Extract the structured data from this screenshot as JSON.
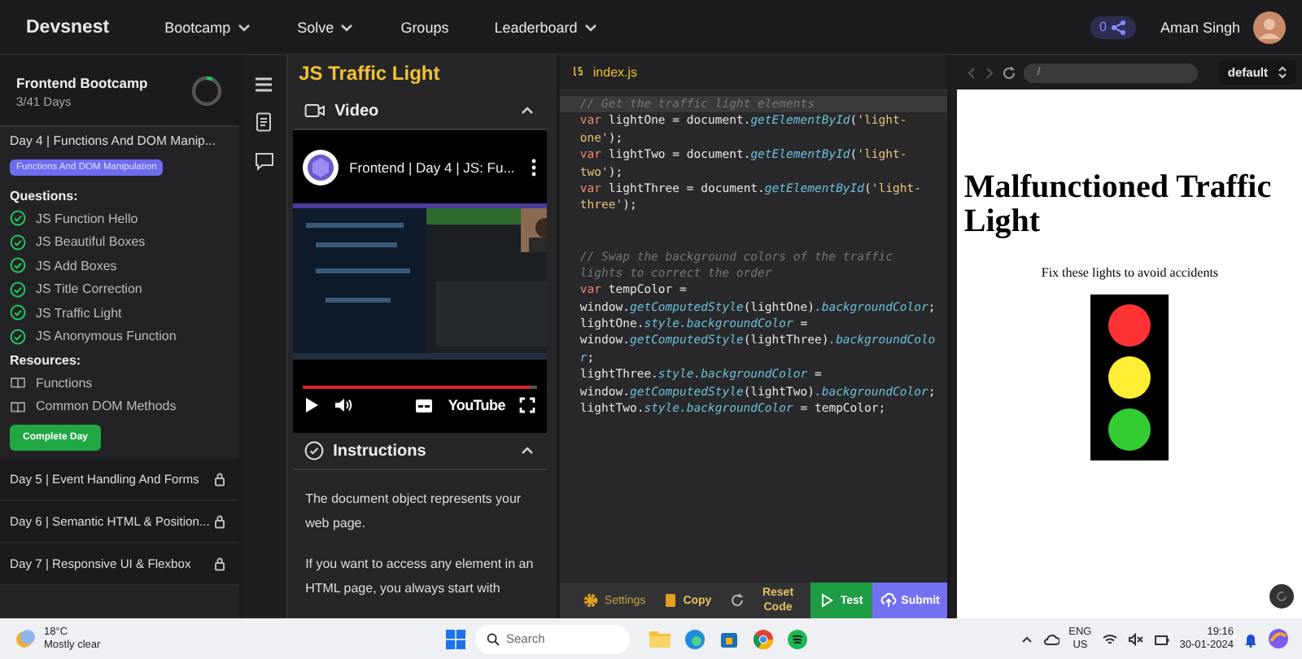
{
  "nav": {
    "brand": "Devsnest",
    "menus": [
      {
        "label": "Bootcamp",
        "dropdown": true
      },
      {
        "label": "Solve",
        "dropdown": true
      },
      {
        "label": "Groups",
        "dropdown": false
      },
      {
        "label": "Leaderboard",
        "dropdown": true
      }
    ],
    "share_count": "0",
    "user": "Aman Singh"
  },
  "sidebar": {
    "course": "Frontend Bootcamp",
    "progress_text": "3/41 Days",
    "progress": {
      "level": 0.07
    },
    "current_day": {
      "title": "Day 4 | Functions And DOM Manip...",
      "tag": "Functions And DOM Manipulation",
      "questions_heading": "Questions:",
      "questions": [
        {
          "label": "JS Function Hello",
          "completed": true
        },
        {
          "label": "JS Beautiful Boxes",
          "completed": true
        },
        {
          "label": "JS Add Boxes",
          "completed": true
        },
        {
          "label": "JS Title Correction",
          "completed": true
        },
        {
          "label": "JS Traffic Light",
          "completed": true
        },
        {
          "label": "JS Anonymous Function",
          "completed": true
        }
      ],
      "resources_heading": "Resources:",
      "resources": [
        "Functions",
        "Common DOM Methods"
      ],
      "complete_button": "Complete Day"
    },
    "days": [
      {
        "label": "Day 5 | Event Handling And Forms",
        "locked": true
      },
      {
        "label": "Day 6 | Semantic HTML & Position...",
        "locked": true
      },
      {
        "label": "Day 7 | Responsive UI & Flexbox",
        "locked": true
      }
    ]
  },
  "lesson": {
    "title": "JS Traffic Light",
    "video_heading": "Video",
    "video": {
      "title": "Frontend | Day 4 | JS: Fu...",
      "progress": {
        "level": 0.97
      },
      "logo": "YouTube"
    },
    "instructions_heading": "Instructions",
    "paragraphs": [
      "The document object represents your web page.",
      "If you want to access any element in an HTML page, you always start with"
    ]
  },
  "editor": {
    "file": "index.js",
    "lines": [
      {
        "highlighted": true,
        "gap_before": false,
        "tokens": [
          {
            "kind": "comment",
            "text": "// Get the traffic light elements"
          }
        ]
      },
      {
        "highlighted": false,
        "gap_before": false,
        "tokens": [
          {
            "kind": "keyword",
            "text": "var"
          },
          {
            "kind": "plain",
            "text": " lightOne = document."
          },
          {
            "kind": "method",
            "text": "getElementById"
          },
          {
            "kind": "plain",
            "text": "("
          },
          {
            "kind": "string",
            "text": "'light-"
          }
        ]
      },
      {
        "highlighted": false,
        "gap_before": false,
        "tokens": [
          {
            "kind": "string",
            "text": "one'"
          },
          {
            "kind": "plain",
            "text": ");"
          }
        ]
      },
      {
        "highlighted": false,
        "gap_before": false,
        "tokens": [
          {
            "kind": "keyword",
            "text": "var"
          },
          {
            "kind": "plain",
            "text": " lightTwo = document."
          },
          {
            "kind": "method",
            "text": "getElementById"
          },
          {
            "kind": "plain",
            "text": "("
          },
          {
            "kind": "string",
            "text": "'light-"
          }
        ]
      },
      {
        "highlighted": false,
        "gap_before": false,
        "tokens": [
          {
            "kind": "string",
            "text": "two'"
          },
          {
            "kind": "plain",
            "text": ");"
          }
        ]
      },
      {
        "highlighted": false,
        "gap_before": false,
        "tokens": [
          {
            "kind": "keyword",
            "text": "var"
          },
          {
            "kind": "plain",
            "text": " lightThree = document."
          },
          {
            "kind": "method",
            "text": "getElementById"
          },
          {
            "kind": "plain",
            "text": "("
          },
          {
            "kind": "string",
            "text": "'light-"
          }
        ]
      },
      {
        "highlighted": false,
        "gap_before": false,
        "tokens": [
          {
            "kind": "string",
            "text": "three'"
          },
          {
            "kind": "plain",
            "text": ");"
          }
        ]
      },
      {
        "highlighted": false,
        "gap_before": true,
        "tokens": [
          {
            "kind": "comment",
            "text": "// Swap the background colors of the traffic"
          }
        ]
      },
      {
        "highlighted": false,
        "gap_before": false,
        "tokens": [
          {
            "kind": "comment",
            "text": "lights to correct the order"
          }
        ]
      },
      {
        "highlighted": false,
        "gap_before": false,
        "tokens": [
          {
            "kind": "keyword",
            "text": "var"
          },
          {
            "kind": "plain",
            "text": " tempColor ="
          }
        ]
      },
      {
        "highlighted": false,
        "gap_before": false,
        "tokens": [
          {
            "kind": "plain",
            "text": "window."
          },
          {
            "kind": "method",
            "text": "getComputedStyle"
          },
          {
            "kind": "plain",
            "text": "(lightOne)"
          },
          {
            "kind": "method",
            "text": ".backgroundColor"
          },
          {
            "kind": "plain",
            "text": ";"
          }
        ]
      },
      {
        "highlighted": false,
        "gap_before": false,
        "tokens": [
          {
            "kind": "plain",
            "text": "lightOne."
          },
          {
            "kind": "method",
            "text": "style.backgroundColor"
          },
          {
            "kind": "plain",
            "text": " ="
          }
        ]
      },
      {
        "highlighted": false,
        "gap_before": false,
        "tokens": [
          {
            "kind": "plain",
            "text": "window."
          },
          {
            "kind": "method",
            "text": "getComputedStyle"
          },
          {
            "kind": "plain",
            "text": "(lightThree)"
          },
          {
            "kind": "method",
            "text": ".backgroundColo"
          }
        ]
      },
      {
        "highlighted": false,
        "gap_before": false,
        "tokens": [
          {
            "kind": "method",
            "text": "r"
          },
          {
            "kind": "plain",
            "text": ";"
          }
        ]
      },
      {
        "highlighted": false,
        "gap_before": false,
        "tokens": [
          {
            "kind": "plain",
            "text": "lightThree."
          },
          {
            "kind": "method",
            "text": "style.backgroundColor"
          },
          {
            "kind": "plain",
            "text": " ="
          }
        ]
      },
      {
        "highlighted": false,
        "gap_before": false,
        "tokens": [
          {
            "kind": "plain",
            "text": "window."
          },
          {
            "kind": "method",
            "text": "getComputedStyle"
          },
          {
            "kind": "plain",
            "text": "(lightTwo)"
          },
          {
            "kind": "method",
            "text": ".backgroundColor"
          },
          {
            "kind": "plain",
            "text": ";"
          }
        ]
      },
      {
        "highlighted": false,
        "gap_before": false,
        "tokens": [
          {
            "kind": "plain",
            "text": "lightTwo."
          },
          {
            "kind": "method",
            "text": "style.backgroundColor"
          },
          {
            "kind": "plain",
            "text": " = tempColor;"
          }
        ]
      }
    ],
    "actions": [
      {
        "label": "Settings",
        "kind": "settings"
      },
      {
        "label": "Copy",
        "kind": "copy"
      },
      {
        "label": "Reset Code",
        "kind": "reset"
      },
      {
        "label": "Test",
        "kind": "test"
      },
      {
        "label": "Submit",
        "kind": "submit"
      }
    ]
  },
  "preview": {
    "url": "/",
    "theme": "default",
    "heading": "Malfunctioned Traffic Light",
    "text": "Fix these lights to avoid accidents",
    "lights": [
      {
        "color": "#ff3333"
      },
      {
        "color": "#ffee33"
      },
      {
        "color": "#33cc33"
      }
    ]
  },
  "taskbar": {
    "temperature": "18°C",
    "weather": "Mostly clear",
    "search_placeholder": "Search",
    "language": "ENG",
    "region": "US",
    "time": "19:16",
    "date": "30-01-2024"
  }
}
